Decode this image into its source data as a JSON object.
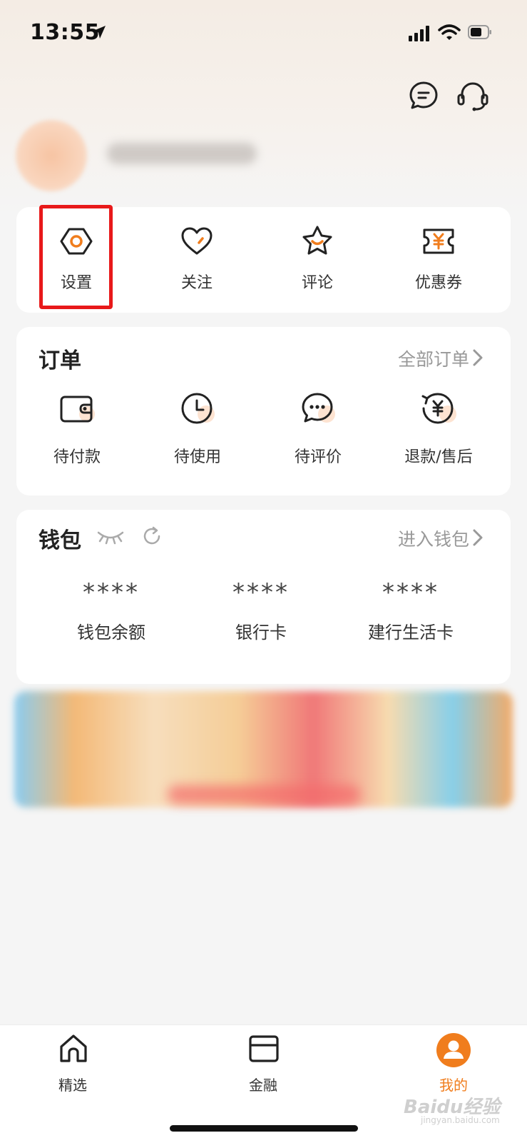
{
  "status_bar": {
    "time": "13:55"
  },
  "quick_actions": [
    {
      "label": "设置",
      "icon": "settings-hexagon-icon"
    },
    {
      "label": "关注",
      "icon": "heart-icon"
    },
    {
      "label": "评论",
      "icon": "star-smile-icon"
    },
    {
      "label": "优惠券",
      "icon": "coupon-yen-icon"
    }
  ],
  "orders": {
    "title": "订单",
    "link": "全部订单",
    "items": [
      {
        "label": "待付款",
        "icon": "wallet-icon"
      },
      {
        "label": "待使用",
        "icon": "clock-icon"
      },
      {
        "label": "待评价",
        "icon": "chat-bubble-icon"
      },
      {
        "label": "退款/售后",
        "icon": "refund-yen-icon"
      }
    ]
  },
  "wallet": {
    "title": "钱包",
    "link": "进入钱包",
    "items": [
      {
        "value": "****",
        "label": "钱包余额"
      },
      {
        "value": "****",
        "label": "银行卡"
      },
      {
        "value": "****",
        "label": "建行生活卡"
      }
    ]
  },
  "tab_bar": {
    "tabs": [
      {
        "label": "精选",
        "icon": "home-icon",
        "active": false
      },
      {
        "label": "金融",
        "icon": "card-icon",
        "active": false
      },
      {
        "label": "我的",
        "icon": "profile-icon",
        "active": true
      }
    ]
  },
  "watermark": {
    "text": "Baidu经验",
    "sub": "jingyan.baidu.com"
  },
  "colors": {
    "accent": "#f07d1d",
    "highlight": "#e8191a",
    "background": "#f5f5f5"
  }
}
